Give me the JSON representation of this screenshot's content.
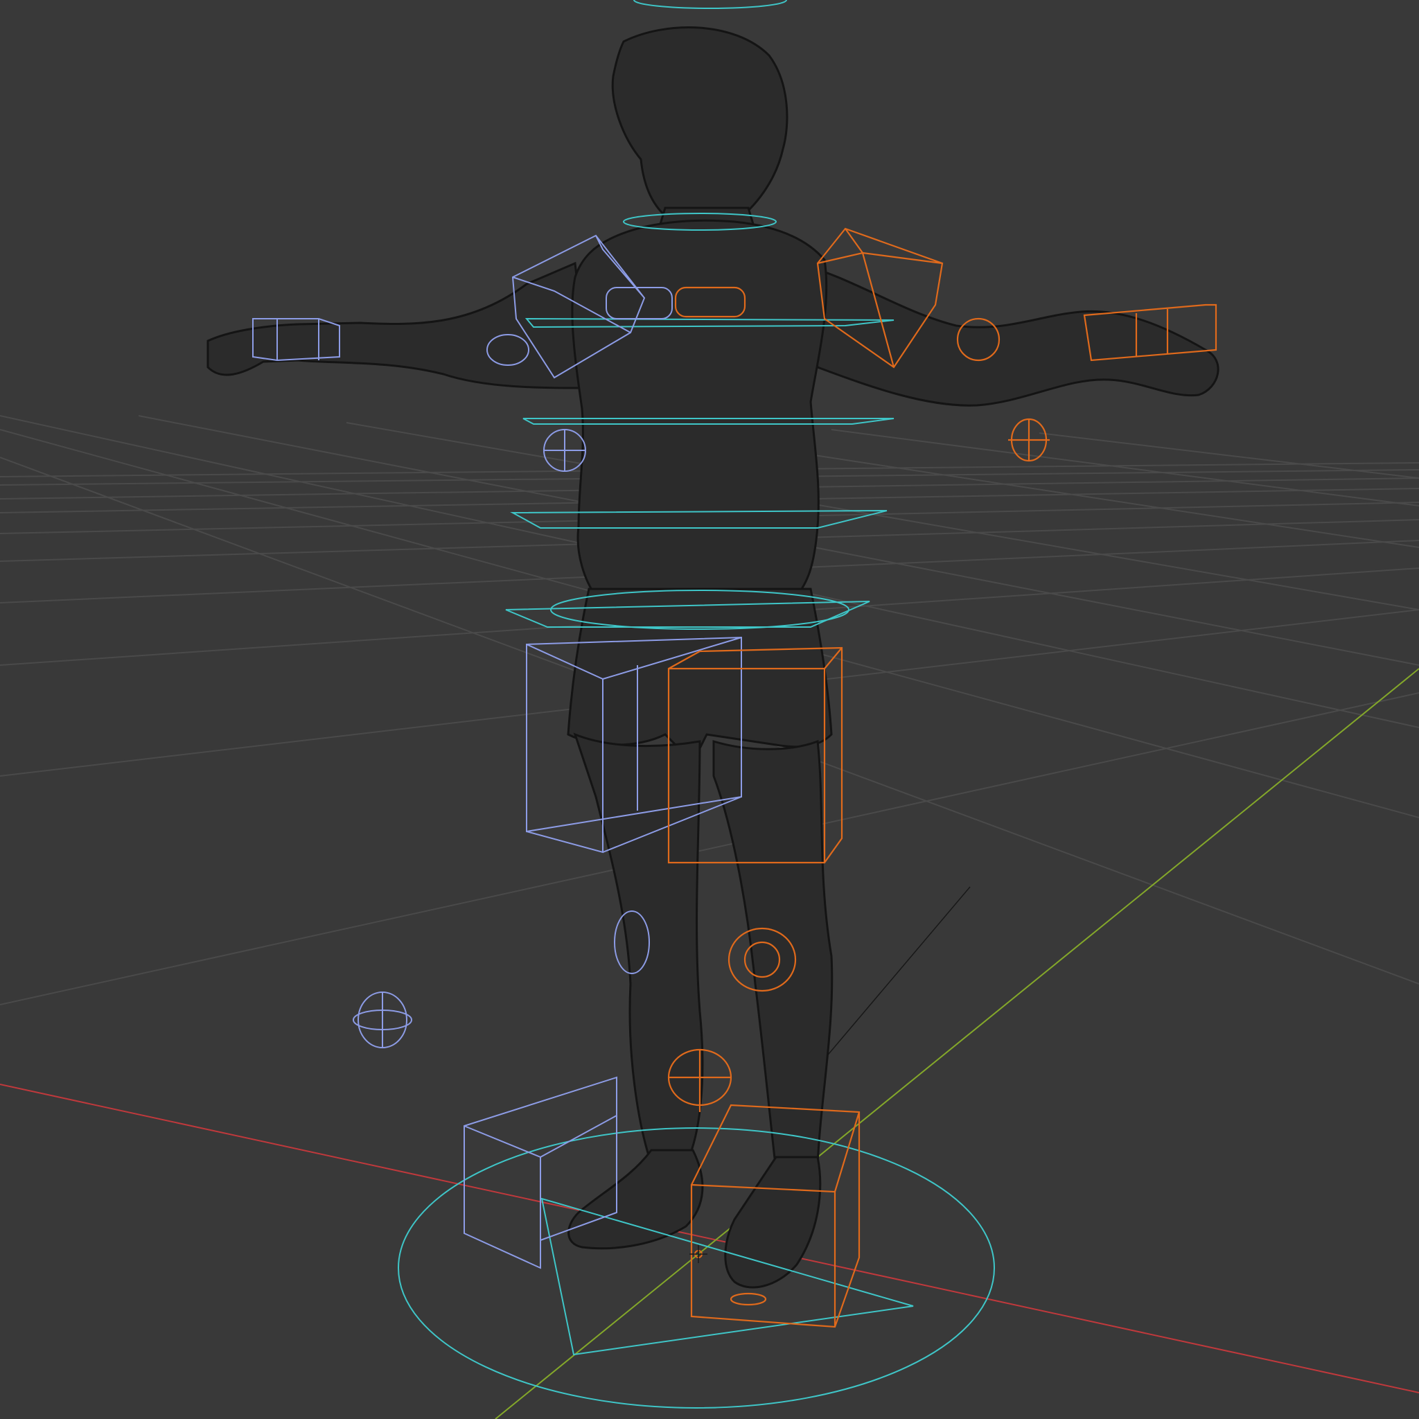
{
  "viewport": {
    "mode": "wireframe",
    "background_color": "#393939",
    "grid_color": "#4a4a4a",
    "axis_x_color": "#c0393c",
    "axis_y_color": "#84a82a",
    "mesh_wire_color": "#141414"
  },
  "rig": {
    "center_controls_color": "#3fc6c8",
    "right_side_controls_color": "#8d9ce6",
    "left_side_controls_color": "#e06a1c"
  }
}
